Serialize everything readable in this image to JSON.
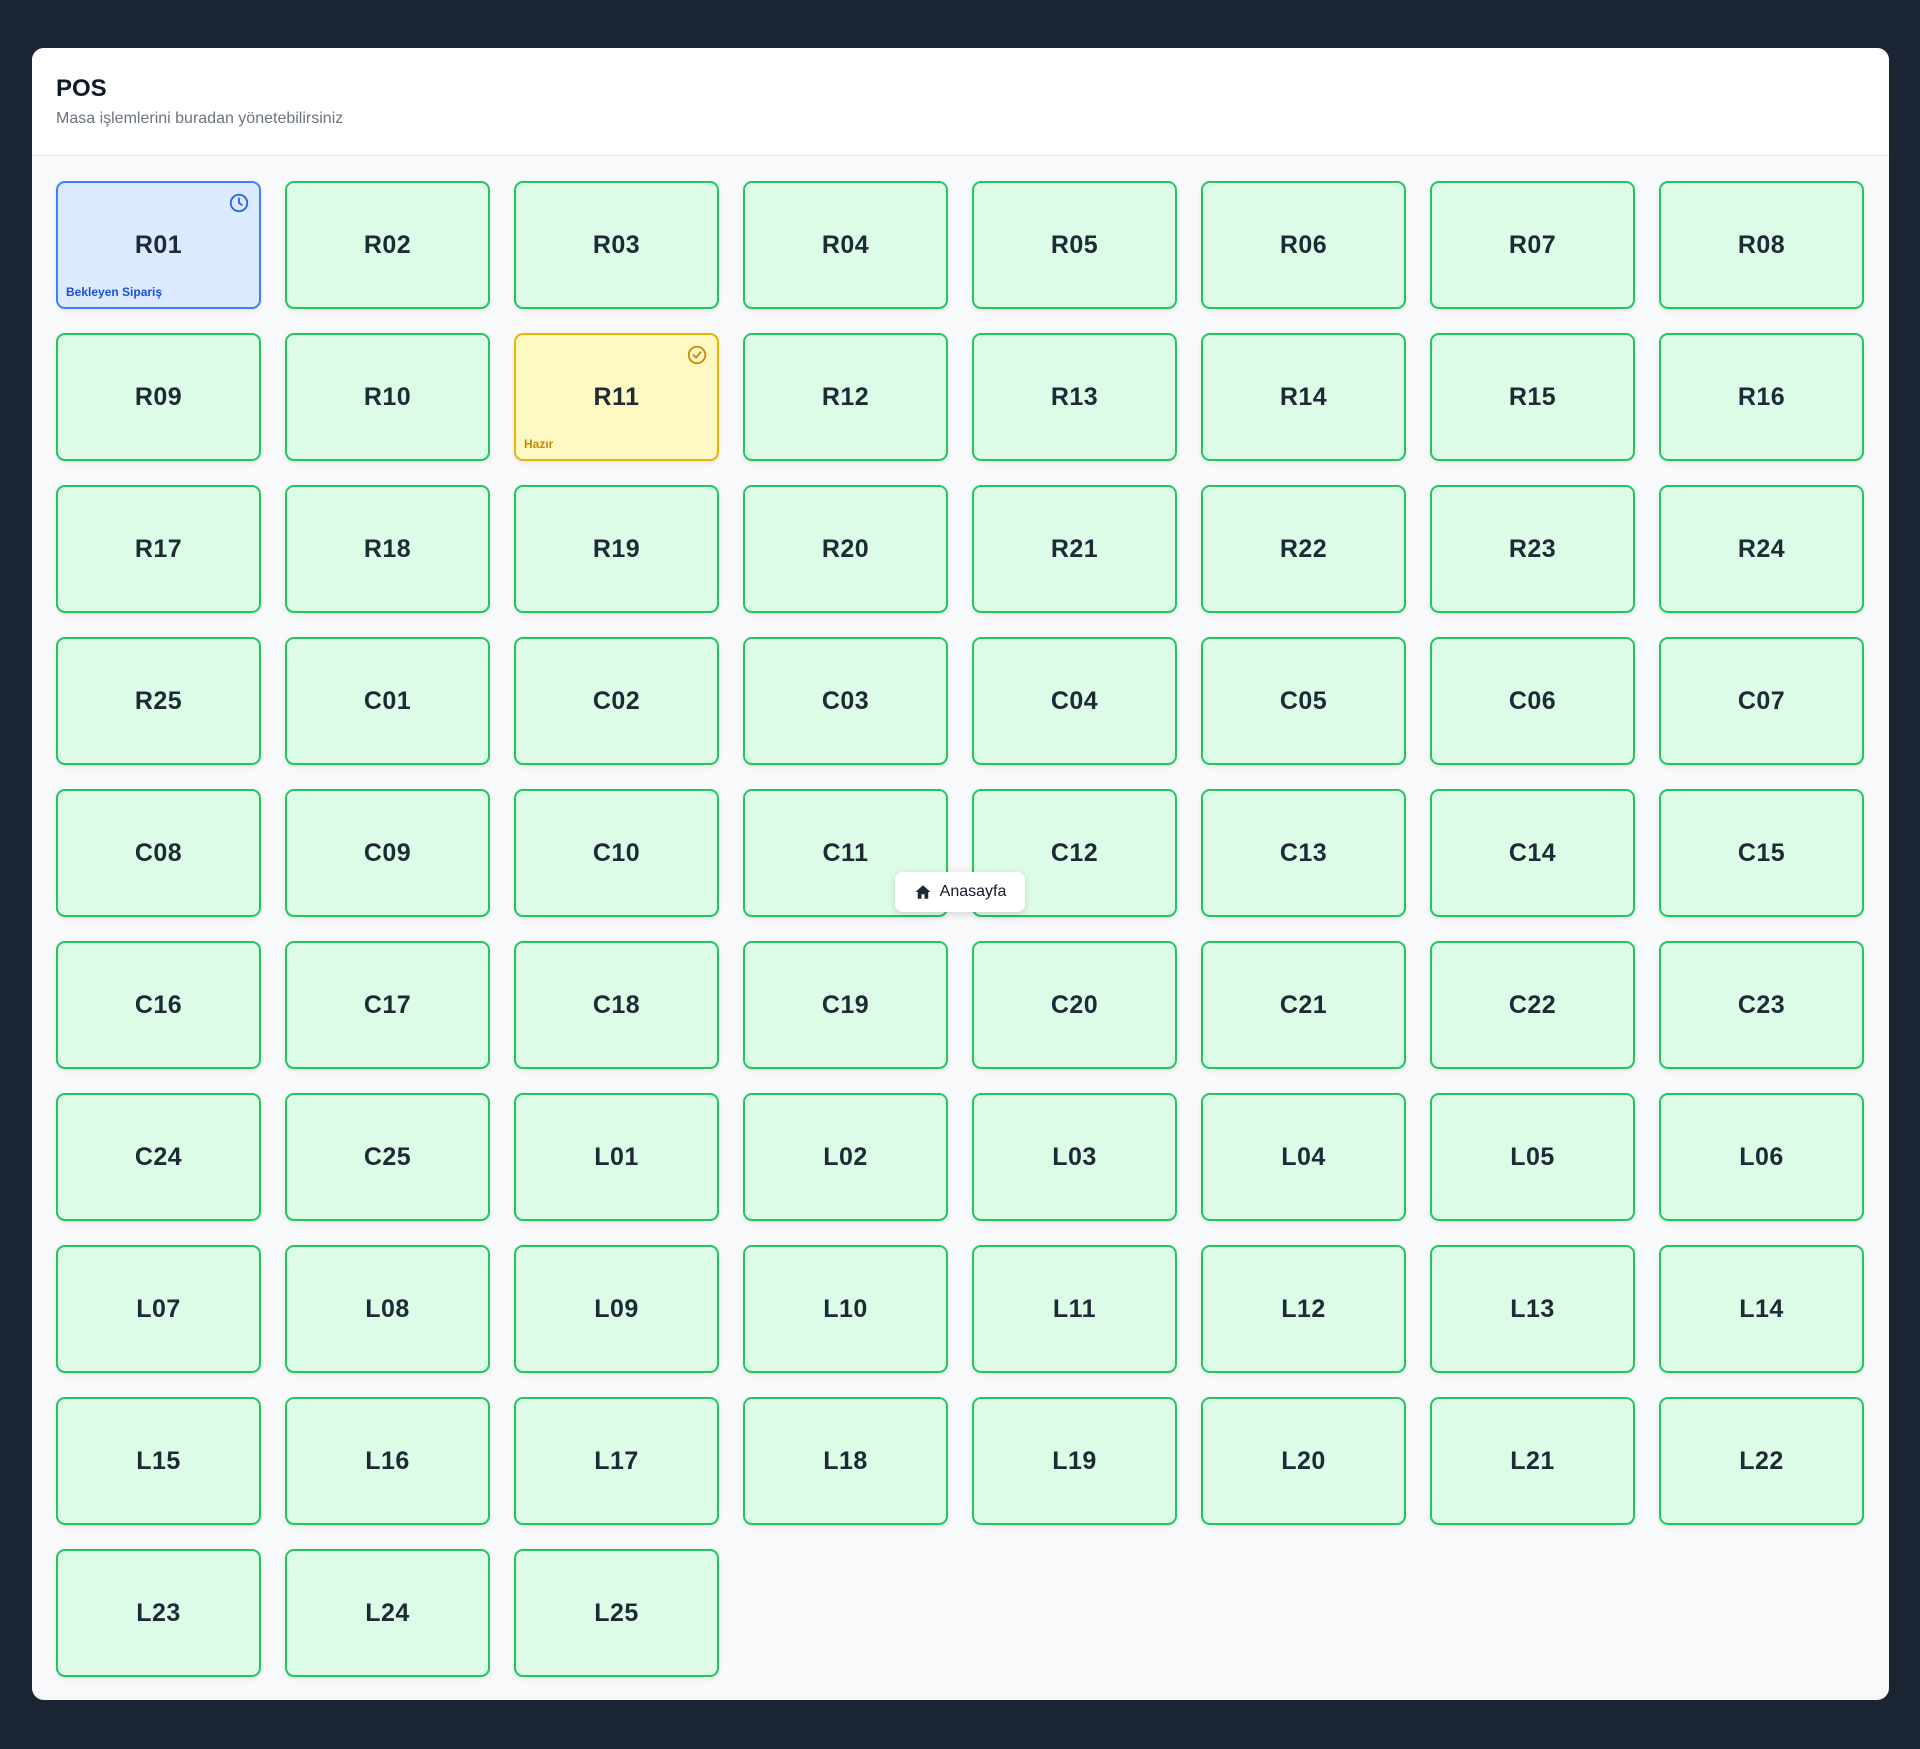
{
  "header": {
    "title": "POS",
    "subtitle": "Masa işlemlerini buradan yönetebilirsiniz"
  },
  "colors": {
    "empty_border": "#22c55e",
    "empty_bg": "#dcfce7",
    "pending_border": "#3b82f6",
    "pending_bg": "#dbeafe",
    "ready_border": "#eab308",
    "ready_bg": "#fef9c3"
  },
  "tables": [
    {
      "name": "R01",
      "status": "pending",
      "status_label": "Bekleyen Sipariş",
      "icon": "clock-icon"
    },
    {
      "name": "R02"
    },
    {
      "name": "R03"
    },
    {
      "name": "R04"
    },
    {
      "name": "R05"
    },
    {
      "name": "R06"
    },
    {
      "name": "R07"
    },
    {
      "name": "R08"
    },
    {
      "name": "R09"
    },
    {
      "name": "R10"
    },
    {
      "name": "R11",
      "status": "ready",
      "status_label": "Hazır",
      "icon": "check-circle-icon"
    },
    {
      "name": "R12"
    },
    {
      "name": "R13"
    },
    {
      "name": "R14"
    },
    {
      "name": "R15"
    },
    {
      "name": "R16"
    },
    {
      "name": "R17"
    },
    {
      "name": "R18"
    },
    {
      "name": "R19"
    },
    {
      "name": "R20"
    },
    {
      "name": "R21"
    },
    {
      "name": "R22"
    },
    {
      "name": "R23"
    },
    {
      "name": "R24"
    },
    {
      "name": "R25"
    },
    {
      "name": "C01"
    },
    {
      "name": "C02"
    },
    {
      "name": "C03"
    },
    {
      "name": "C04"
    },
    {
      "name": "C05"
    },
    {
      "name": "C06"
    },
    {
      "name": "C07"
    },
    {
      "name": "C08"
    },
    {
      "name": "C09"
    },
    {
      "name": "C10"
    },
    {
      "name": "C11"
    },
    {
      "name": "C12"
    },
    {
      "name": "C13"
    },
    {
      "name": "C14"
    },
    {
      "name": "C15"
    },
    {
      "name": "C16"
    },
    {
      "name": "C17"
    },
    {
      "name": "C18"
    },
    {
      "name": "C19"
    },
    {
      "name": "C20"
    },
    {
      "name": "C21"
    },
    {
      "name": "C22"
    },
    {
      "name": "C23"
    },
    {
      "name": "C24"
    },
    {
      "name": "C25"
    },
    {
      "name": "L01"
    },
    {
      "name": "L02"
    },
    {
      "name": "L03"
    },
    {
      "name": "L04"
    },
    {
      "name": "L05"
    },
    {
      "name": "L06"
    },
    {
      "name": "L07"
    },
    {
      "name": "L08"
    },
    {
      "name": "L09"
    },
    {
      "name": "L10"
    },
    {
      "name": "L11"
    },
    {
      "name": "L12"
    },
    {
      "name": "L13"
    },
    {
      "name": "L14"
    },
    {
      "name": "L15"
    },
    {
      "name": "L16"
    },
    {
      "name": "L17"
    },
    {
      "name": "L18"
    },
    {
      "name": "L19"
    },
    {
      "name": "L20"
    },
    {
      "name": "L21"
    },
    {
      "name": "L22"
    },
    {
      "name": "L23"
    },
    {
      "name": "L24"
    },
    {
      "name": "L25"
    }
  ],
  "home_button": {
    "label": "Anasayfa",
    "icon": "home-icon"
  }
}
